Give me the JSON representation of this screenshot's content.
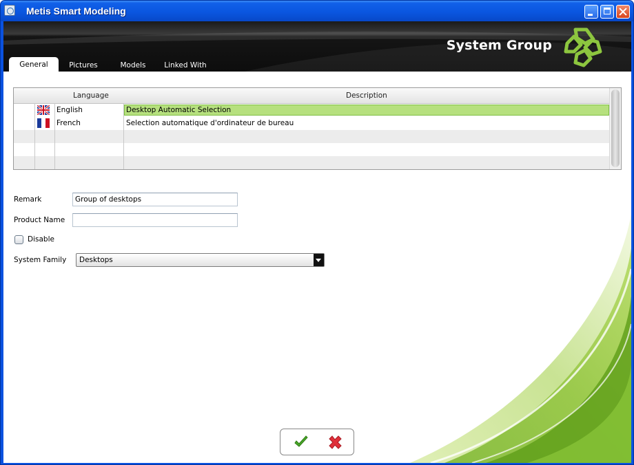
{
  "window": {
    "title": "Metis Smart Modeling"
  },
  "header": {
    "title": "System Group"
  },
  "tabs": [
    {
      "label": "General",
      "active": true
    },
    {
      "label": "Pictures",
      "active": false
    },
    {
      "label": "Models",
      "active": false
    },
    {
      "label": "Linked With",
      "active": false
    }
  ],
  "grid": {
    "columns": {
      "language": "Language",
      "description": "Description"
    },
    "rows": [
      {
        "flag": "uk-flag-icon",
        "language": "English",
        "description": "Desktop Automatic Selection",
        "selected": true
      },
      {
        "flag": "france-flag-icon",
        "language": "French",
        "description": "Selection automatique d'ordinateur de bureau",
        "selected": false
      }
    ]
  },
  "form": {
    "remark_label": "Remark",
    "remark_value": "Group of desktops",
    "product_name_label": "Product Name",
    "product_name_value": "",
    "disable_label": "Disable",
    "disable_checked": false,
    "system_family_label": "System Family",
    "system_family_value": "Desktops"
  },
  "buttons": {
    "ok": "check-icon",
    "cancel": "cross-icon"
  },
  "colors": {
    "accent_green": "#8dc63f",
    "selection": "#b6e07e",
    "titlebar": "#0a56e0"
  }
}
